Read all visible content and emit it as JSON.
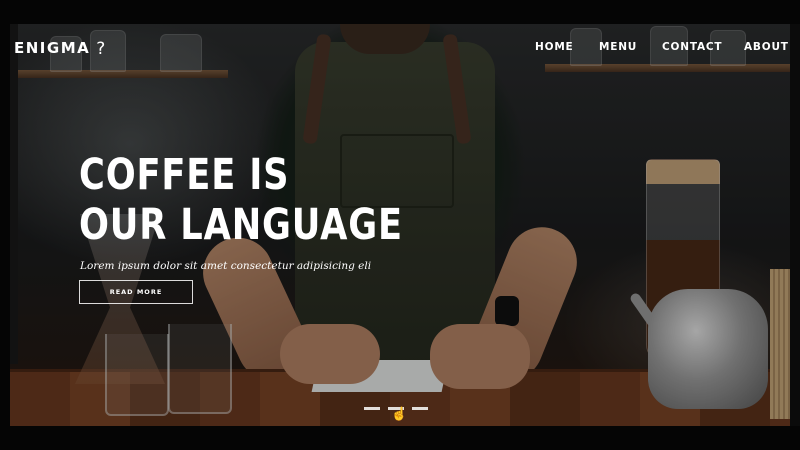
{
  "brand": {
    "name": "ENIGMA",
    "icon": "question-mark-icon",
    "icon_glyph": "?"
  },
  "nav": {
    "home": "HOME",
    "menu": "MENU",
    "contact": "CONTACT",
    "about": "ABOUT"
  },
  "hero": {
    "headline_line1": "COFFEE IS",
    "headline_line2": "OUR LANGUAGE",
    "tagline": "Lorem ipsum dolor sit amet consectetur adipisicing eli",
    "cta_label": "READ MORE",
    "background": "barista-at-coffee-counter-photo"
  },
  "slider": {
    "slides": 3,
    "active_slide": 2
  },
  "colors": {
    "text": "#ffffff",
    "background": "#050505",
    "counter_wood": "#6b3a20"
  }
}
